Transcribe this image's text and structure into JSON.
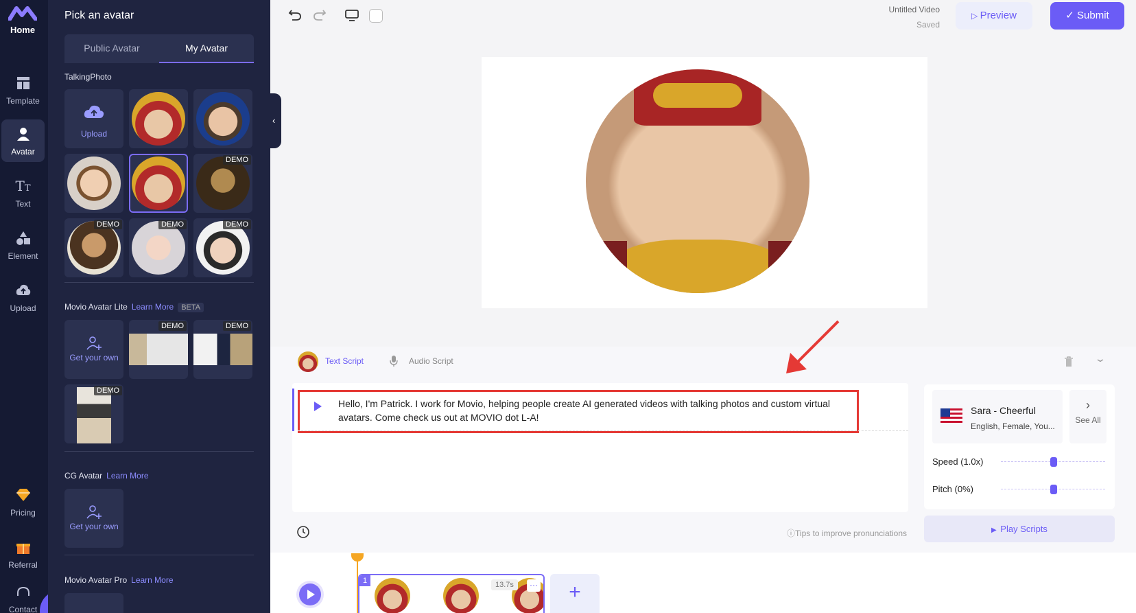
{
  "nav": {
    "home": "Home",
    "items": [
      {
        "label": "Template",
        "icon": "template-icon"
      },
      {
        "label": "Avatar",
        "icon": "avatar-icon"
      },
      {
        "label": "Text",
        "icon": "text-icon"
      },
      {
        "label": "Element",
        "icon": "element-icon"
      },
      {
        "label": "Upload",
        "icon": "upload-cloud-icon"
      },
      {
        "label": "Pricing",
        "icon": "diamond-icon"
      },
      {
        "label": "Referral",
        "icon": "gift-icon"
      },
      {
        "label": "Contact",
        "icon": "headset-icon"
      }
    ]
  },
  "panel": {
    "title": "Pick an avatar",
    "tabs": [
      "Public Avatar",
      "My Avatar"
    ],
    "talking_photo": "TalkingPhoto",
    "upload": "Upload",
    "demo": "DEMO",
    "lite": {
      "title": "Movio Avatar Lite",
      "learn": "Learn More",
      "beta": "BETA",
      "get_own": "Get your own"
    },
    "cg": {
      "title": "CG Avatar",
      "learn": "Learn More",
      "get_own": "Get your own"
    },
    "pro": {
      "title": "Movio Avatar Pro",
      "learn": "Learn More"
    }
  },
  "topbar": {
    "video_title": "Untitled Video",
    "saved": "Saved",
    "preview": "Preview",
    "submit": "Submit"
  },
  "script": {
    "tab_text": "Text Script",
    "tab_audio": "Audio Script",
    "text": "Hello, I'm Patrick. I work for Movio, helping people create AI generated videos with talking photos and custom virtual avatars. Come check us out at MOVIO dot L-A!",
    "tips": "Tips to improve pronunciations"
  },
  "voice": {
    "name": "Sara - Cheerful",
    "desc": "English, Female, You...",
    "see_all": "See All",
    "speed": "Speed (1.0x)",
    "pitch": "Pitch (0%)",
    "speed_level": 0.5,
    "pitch_level": 0.5,
    "play": "Play Scripts"
  },
  "timeline": {
    "scene_number": "1",
    "duration": "13.7s",
    "more": "···"
  },
  "colors": {
    "accent": "#6b5cf6",
    "nav_bg": "#151a33",
    "panel_bg": "#1f2440",
    "highlight": "#e53935"
  }
}
